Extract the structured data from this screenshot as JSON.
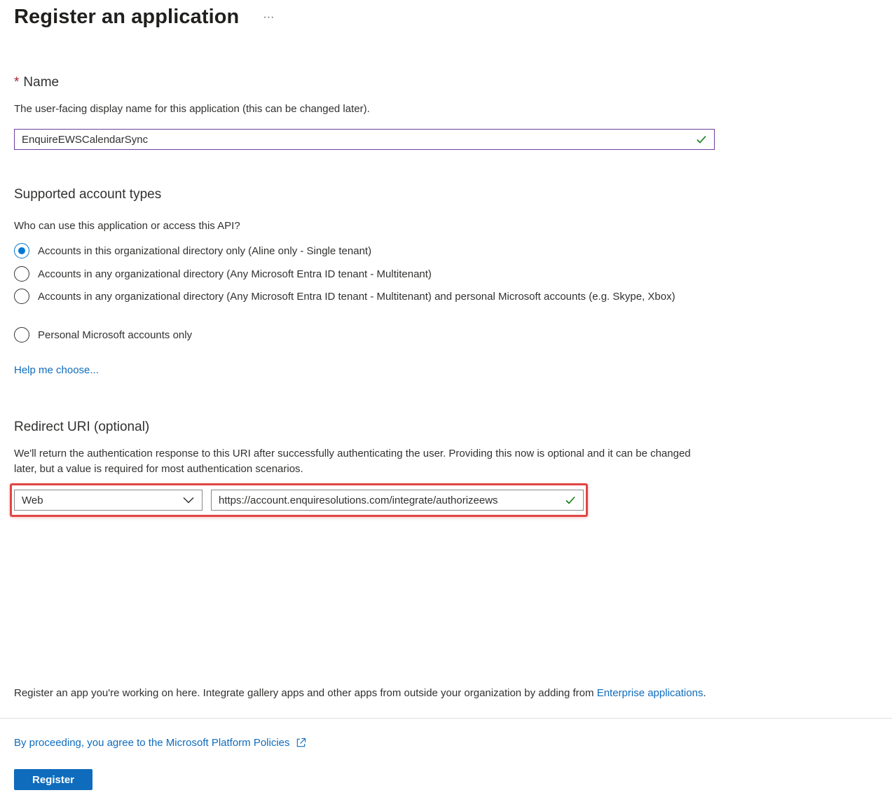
{
  "header": {
    "title": "Register an application",
    "more": "···"
  },
  "name_section": {
    "required_mark": "*",
    "heading": "Name",
    "description": "The user-facing display name for this application (this can be changed later).",
    "value": "EnquireEWSCalendarSync"
  },
  "account_types": {
    "heading": "Supported account types",
    "question": "Who can use this application or access this API?",
    "options": [
      {
        "label": "Accounts in this organizational directory only (Aline only - Single tenant)",
        "selected": true
      },
      {
        "label": "Accounts in any organizational directory (Any Microsoft Entra ID tenant - Multitenant)",
        "selected": false
      },
      {
        "label": "Accounts in any organizational directory (Any Microsoft Entra ID tenant - Multitenant) and personal Microsoft accounts (e.g. Skype, Xbox)",
        "selected": false
      },
      {
        "label": "Personal Microsoft accounts only",
        "selected": false
      }
    ],
    "help_link": "Help me choose..."
  },
  "redirect": {
    "heading": "Redirect URI (optional)",
    "description": "We'll return the authentication response to this URI after successfully authenticating the user. Providing this now is optional and it can be changed later, but a value is required for most authentication scenarios.",
    "platform": "Web",
    "uri": "https://account.enquiresolutions.com/integrate/authorizeews"
  },
  "footer": {
    "note_text": "Register an app you're working on here. Integrate gallery apps and other apps from outside your organization by adding from ",
    "note_link": "Enterprise applications",
    "note_end": ".",
    "policy_link": "By proceeding, you agree to the Microsoft Platform Policies",
    "register_label": "Register"
  },
  "colors": {
    "accent": "#0f6cbd",
    "radio_selected": "#0078d4",
    "valid_check": "#107c10",
    "highlight": "#e04545",
    "required": "#a4262c"
  }
}
